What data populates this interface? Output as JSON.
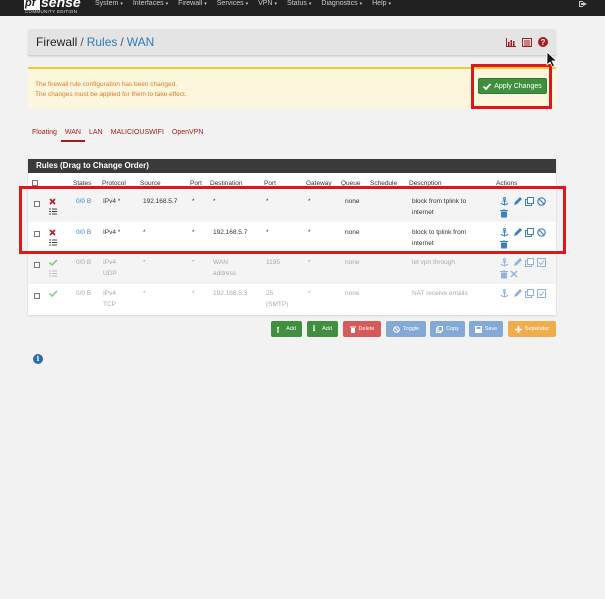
{
  "brand": {
    "logo_left": "pf",
    "logo_right": "sense",
    "edition": "COMMUNITY EDITION"
  },
  "nav": {
    "items": [
      {
        "label": "System"
      },
      {
        "label": "Interfaces"
      },
      {
        "label": "Firewall"
      },
      {
        "label": "Services"
      },
      {
        "label": "VPN"
      },
      {
        "label": "Status"
      },
      {
        "label": "Diagnostics"
      },
      {
        "label": "Help"
      }
    ],
    "caret": "▾"
  },
  "breadcrumb": {
    "part1": "Firewall",
    "part2": "Rules",
    "part3": "WAN",
    "sep": "/"
  },
  "alert": {
    "line1": "The firewall rule configuration has been changed.",
    "line2": "The changes must be applied for them to take effect.",
    "apply_label": "Apply Changes"
  },
  "tabs": [
    {
      "label": "Floating"
    },
    {
      "label": "WAN"
    },
    {
      "label": "LAN"
    },
    {
      "label": "MALICIOUSWIFI"
    },
    {
      "label": "OpenVPN"
    }
  ],
  "rules": {
    "heading": "Rules (Drag to Change Order)",
    "columns": {
      "states": "States",
      "protocol": "Protocol",
      "source": "Source",
      "port": "Port",
      "destination": "Destination",
      "dport": "Port",
      "gateway": "Gateway",
      "queue": "Queue",
      "schedule": "Schedule",
      "description": "Description",
      "actions": "Actions"
    },
    "rows": [
      {
        "states": "0/0 B",
        "protocol": "IPv4 *",
        "protocol2": "",
        "source": "192.168.5.7",
        "sport": "*",
        "destination": "*",
        "destination2": "",
        "dport": "*",
        "dport2": "",
        "gateway": "*",
        "queue": "none",
        "desc1": "block from tplink to",
        "desc2": "internet"
      },
      {
        "states": "0/0 B",
        "protocol": "IPv4 *",
        "protocol2": "",
        "source": "*",
        "sport": "*",
        "destination": "192.168.5.7",
        "destination2": "",
        "dport": "*",
        "dport2": "",
        "gateway": "*",
        "queue": "none",
        "desc1": "block to tplink from",
        "desc2": "internet"
      },
      {
        "states": "0/0 B",
        "protocol": "IPv4",
        "protocol2": "UDP",
        "source": "*",
        "sport": "*",
        "destination": "WAN",
        "destination2": "address",
        "dport": "1195",
        "dport2": "",
        "gateway": "*",
        "queue": "none",
        "desc1": "let vpn through",
        "desc2": ""
      },
      {
        "states": "0/0 B",
        "protocol": "IPv4",
        "protocol2": "TCP",
        "source": "*",
        "sport": "*",
        "destination": "192.168.5.3",
        "destination2": "",
        "dport": "25",
        "dport2": "(SMTP)",
        "gateway": "*",
        "queue": "none",
        "desc1": "NAT receive emails",
        "desc2": ""
      }
    ]
  },
  "buttons": {
    "add_top": "Add",
    "add_bottom": "Add",
    "delete": "Delete",
    "toggle": "Toggle",
    "copy": "Copy",
    "save": "Save",
    "separator": "Separator"
  },
  "icons": {
    "block": "x-icon",
    "pass": "check-icon",
    "anchor": "anchor-icon",
    "edit": "pencil-icon",
    "copy": "copy-icon",
    "disable": "ban-icon",
    "delete": "trash-icon",
    "info": "info-icon"
  },
  "colors": {
    "accent": "#a61d1d",
    "link": "#2f7ab8",
    "apply": "#3f8f3f",
    "highlight": "#e2151c",
    "alert_text": "#e07b2a"
  }
}
